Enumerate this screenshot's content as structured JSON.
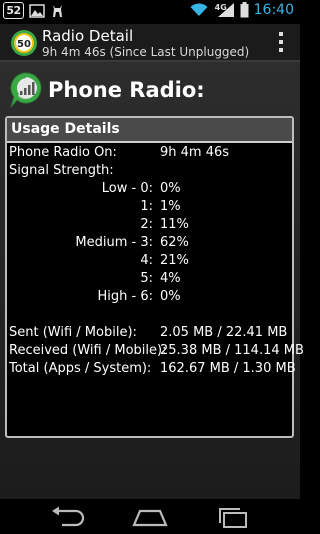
{
  "status_bar": {
    "notification_badge": "52",
    "network_type": "4G",
    "time": "16:40"
  },
  "action_bar": {
    "title": "Radio Detail",
    "subtitle": "9h 4m 46s (Since Last Unplugged)",
    "logo_text": "50"
  },
  "page": {
    "heading": "Phone Radio:"
  },
  "usage": {
    "header": "Usage Details",
    "phone_radio_on_label": "Phone Radio On:",
    "phone_radio_on_value": "9h 4m 46s",
    "signal_strength_label": "Signal Strength:",
    "levels": [
      {
        "label": "Low - 0:",
        "value": "0%"
      },
      {
        "label": "1:",
        "value": "1%"
      },
      {
        "label": "2:",
        "value": "11%"
      },
      {
        "label": "Medium - 3:",
        "value": "62%"
      },
      {
        "label": "4:",
        "value": "21%"
      },
      {
        "label": "5:",
        "value": "4%"
      },
      {
        "label": "High - 6:",
        "value": "0%"
      }
    ],
    "sent_label": "Sent (Wifi / Mobile):",
    "sent_value": "2.05 MB / 22.41 MB",
    "received_label": "Received (Wifi / Mobile):",
    "received_value": "25.38 MB / 114.14 MB",
    "total_label": "Total (Apps / System):",
    "total_value": "162.67 MB / 1.30 MB"
  },
  "colors": {
    "time_accent": "#38b5e6",
    "wifi_accent": "#38b5e6",
    "logo_green": "#3aa845"
  }
}
